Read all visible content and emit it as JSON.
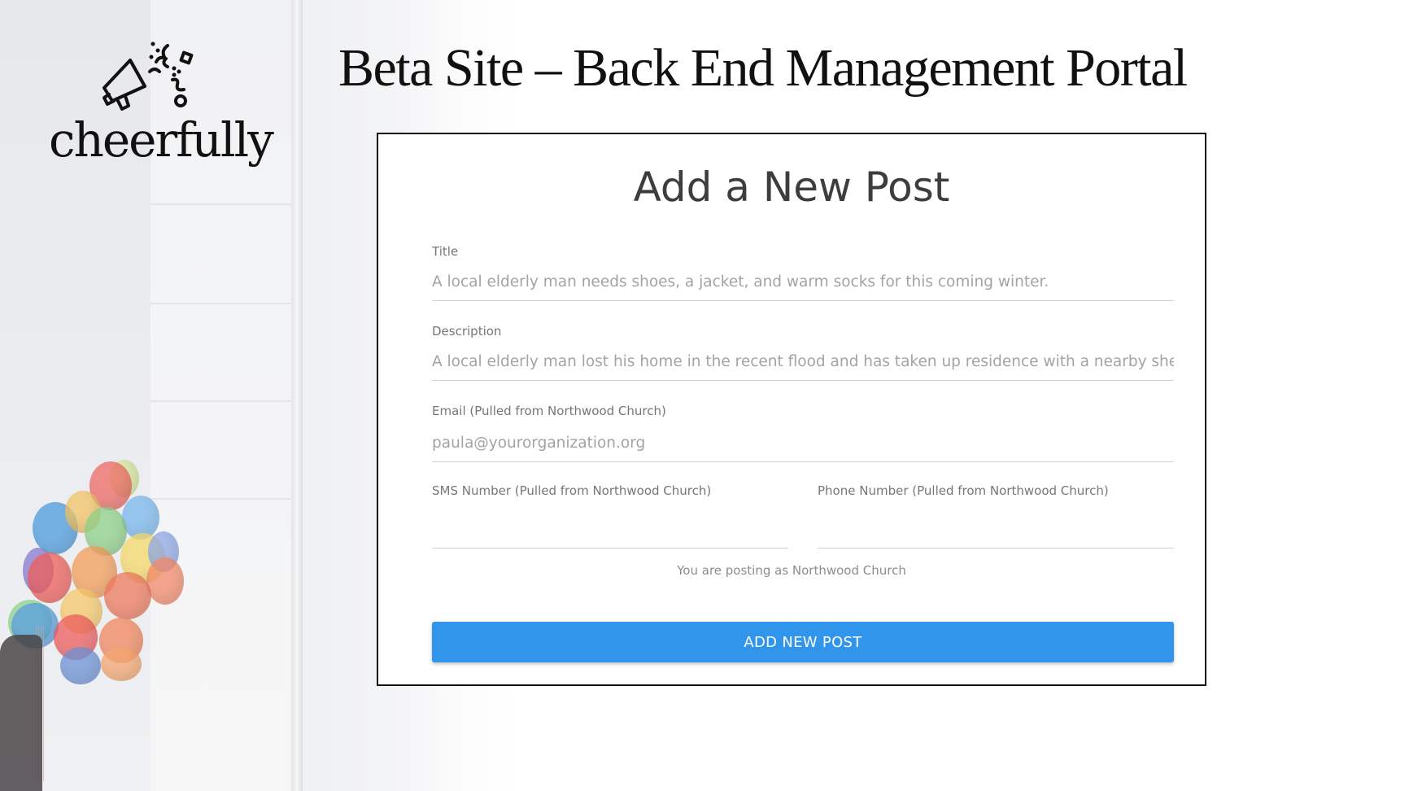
{
  "brand": {
    "name": "cheerfully",
    "icon": "megaphone-confetti-icon"
  },
  "page": {
    "title": "Beta Site – Back End Management Portal"
  },
  "form": {
    "heading": "Add a New Post",
    "title_field": {
      "label": "Title",
      "placeholder": "A local elderly man needs shoes, a jacket, and warm socks for this coming winter."
    },
    "description_field": {
      "label": "Description",
      "placeholder": "A local elderly man lost his home in the recent flood and has taken up residence with a nearby shelter."
    },
    "email_field": {
      "label": "Email (Pulled from Northwood Church)",
      "placeholder": "paula@yourorganization.org"
    },
    "sms_field": {
      "label": "SMS Number (Pulled from Northwood Church)",
      "placeholder": ""
    },
    "phone_field": {
      "label": "Phone Number (Pulled from Northwood Church)",
      "placeholder": ""
    },
    "posting_as": "You are posting as Northwood Church",
    "submit_label": "ADD NEW POST"
  },
  "colors": {
    "accent": "#3295ec",
    "heading": "#111111",
    "card_border": "#111111"
  }
}
